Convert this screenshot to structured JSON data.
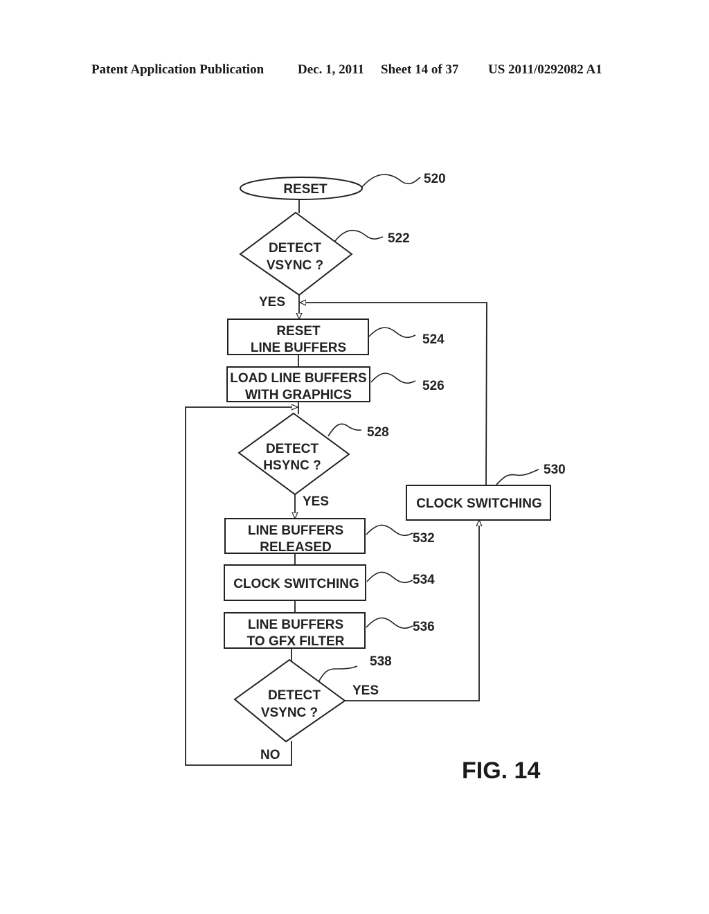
{
  "header": {
    "publication": "Patent Application Publication",
    "date": "Dec. 1, 2011",
    "sheet": "Sheet 14 of 37",
    "number": "US 2011/0292082 A1"
  },
  "figure_label": "FIG. 14",
  "nodes": {
    "n520": {
      "ref": "520",
      "type": "terminal",
      "lines": [
        "RESET"
      ]
    },
    "n522": {
      "ref": "522",
      "type": "decision",
      "lines": [
        "DETECT",
        "VSYNC ?"
      ]
    },
    "n524": {
      "ref": "524",
      "type": "process",
      "lines": [
        "RESET",
        "LINE BUFFERS"
      ]
    },
    "n526": {
      "ref": "526",
      "type": "process",
      "lines": [
        "LOAD LINE BUFFERS",
        "WITH GRAPHICS"
      ]
    },
    "n528": {
      "ref": "528",
      "type": "decision",
      "lines": [
        "DETECT",
        "HSYNC ?"
      ]
    },
    "n530": {
      "ref": "530",
      "type": "process",
      "lines": [
        "CLOCK SWITCHING"
      ]
    },
    "n532": {
      "ref": "532",
      "type": "process",
      "lines": [
        "LINE BUFFERS",
        "RELEASED"
      ]
    },
    "n534": {
      "ref": "534",
      "type": "process",
      "lines": [
        "CLOCK SWITCHING"
      ]
    },
    "n536": {
      "ref": "536",
      "type": "process",
      "lines": [
        "LINE BUFFERS",
        "TO GFX FILTER"
      ]
    },
    "n538": {
      "ref": "538",
      "type": "decision",
      "lines": [
        "DETECT",
        "VSYNC ?"
      ]
    }
  },
  "edge_labels": {
    "e522_yes": "YES",
    "e528_yes": "YES",
    "e538_yes": "YES",
    "e538_no": "NO"
  }
}
